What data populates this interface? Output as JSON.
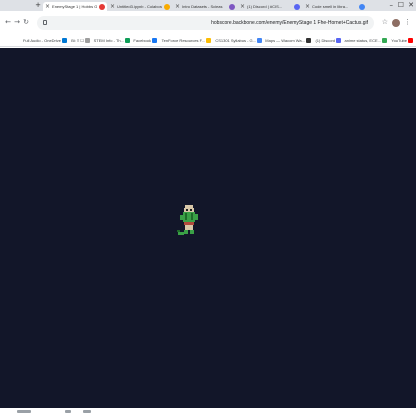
{
  "tabs": [
    {
      "title": "Code smell in libra...",
      "favicon_color": "#4285f4",
      "active": false
    },
    {
      "title": "(1) Discord | #CIS...",
      "favicon_color": "#5865f2",
      "active": false
    },
    {
      "title": "Intro Datasets - Scieas",
      "favicon_color": "#7e57c2",
      "active": false
    },
    {
      "title": "Untitled3.ipynb - Colaboratory",
      "favicon_color": "#f9ab00",
      "active": false
    },
    {
      "title": "EnemyStage 1 | Hobbs Game Mak...",
      "favicon_color": "#e53935",
      "active": true
    }
  ],
  "tab_close_glyph": "×",
  "new_tab_glyph": "+",
  "window_controls": {
    "minimize": "–",
    "maximize": "☐",
    "close": "✕"
  },
  "toolbar": {
    "back": "←",
    "forward": "→",
    "reload": "↻",
    "url": "hobscore.backbone.com/enemy/EnemyStage 1 Fhe-Hornet+Cactus.gif",
    "menu": "⋮",
    "star": "☆"
  },
  "bookmarks": [
    {
      "label": "YouTube",
      "icon_color": "#ff0000"
    },
    {
      "label": "anime status, ECE...",
      "icon_color": "#34a853"
    },
    {
      "label": "(1) Discord",
      "icon_color": "#5865f2"
    },
    {
      "label": "Maps — Wacom Wa...",
      "icon_color": "#333333"
    },
    {
      "label": "CS1301 Syllabus - G...",
      "icon_color": "#4285f4"
    },
    {
      "label": "TenForce Resources F...",
      "icon_color": "#fbbc05"
    },
    {
      "label": "Facebook",
      "icon_color": "#1877f2"
    },
    {
      "label": "STEM Info - Th...",
      "icon_color": "#0f9d58"
    },
    {
      "label": "Bi: ≡ ☐",
      "icon_color": "#9e9e9e"
    },
    {
      "label": "Full Audio - OneDrive",
      "icon_color": "#0078d4"
    }
  ],
  "viewport": {
    "background_color": "#121629",
    "sprite_name": "cactus-hornet-sprite"
  },
  "colors": {
    "sprite_green": "#3aa046",
    "sprite_dark_green": "#1f6b2a",
    "sprite_tan": "#d8c7a8",
    "sprite_red": "#b04a3c"
  }
}
